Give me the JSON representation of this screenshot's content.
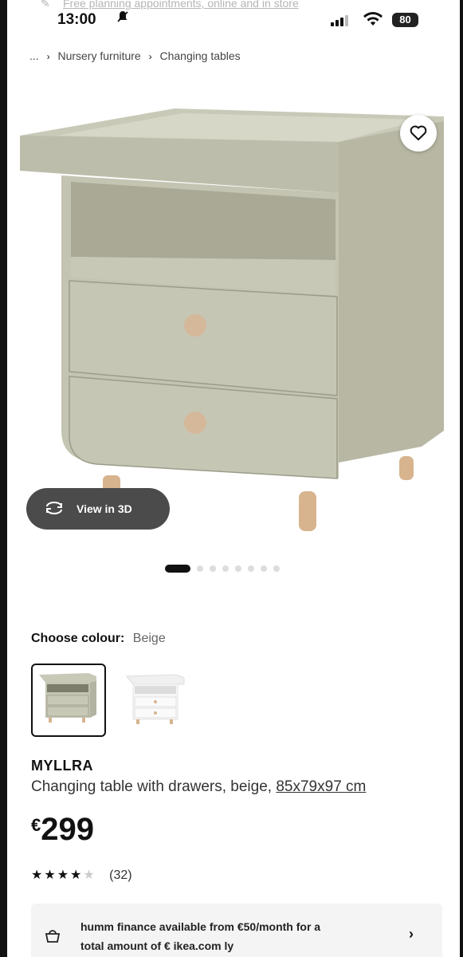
{
  "banner": {
    "text": "Free planning appointments, online and in store"
  },
  "status": {
    "time": "13:00",
    "battery": "80"
  },
  "breadcrumb": {
    "root": "...",
    "items": [
      "Nursery furniture",
      "Changing tables"
    ]
  },
  "media": {
    "view3d_label": "View in 3D",
    "carousel_total": 8,
    "carousel_active": 0
  },
  "colour": {
    "label": "Choose colour:",
    "value": "Beige"
  },
  "product": {
    "name": "MYLLRA",
    "description": "Changing table with drawers, beige,",
    "dimensions": "85x79x97 cm",
    "currency": "€",
    "price": "299",
    "rating_stars": 4,
    "rating_count": "(32)"
  },
  "finance": {
    "line1": "humm finance available from €50/month for a",
    "line2": "total amount of € ikea.com ly"
  },
  "colors": {
    "product": "#c4c4b2",
    "accent": "#111111"
  }
}
